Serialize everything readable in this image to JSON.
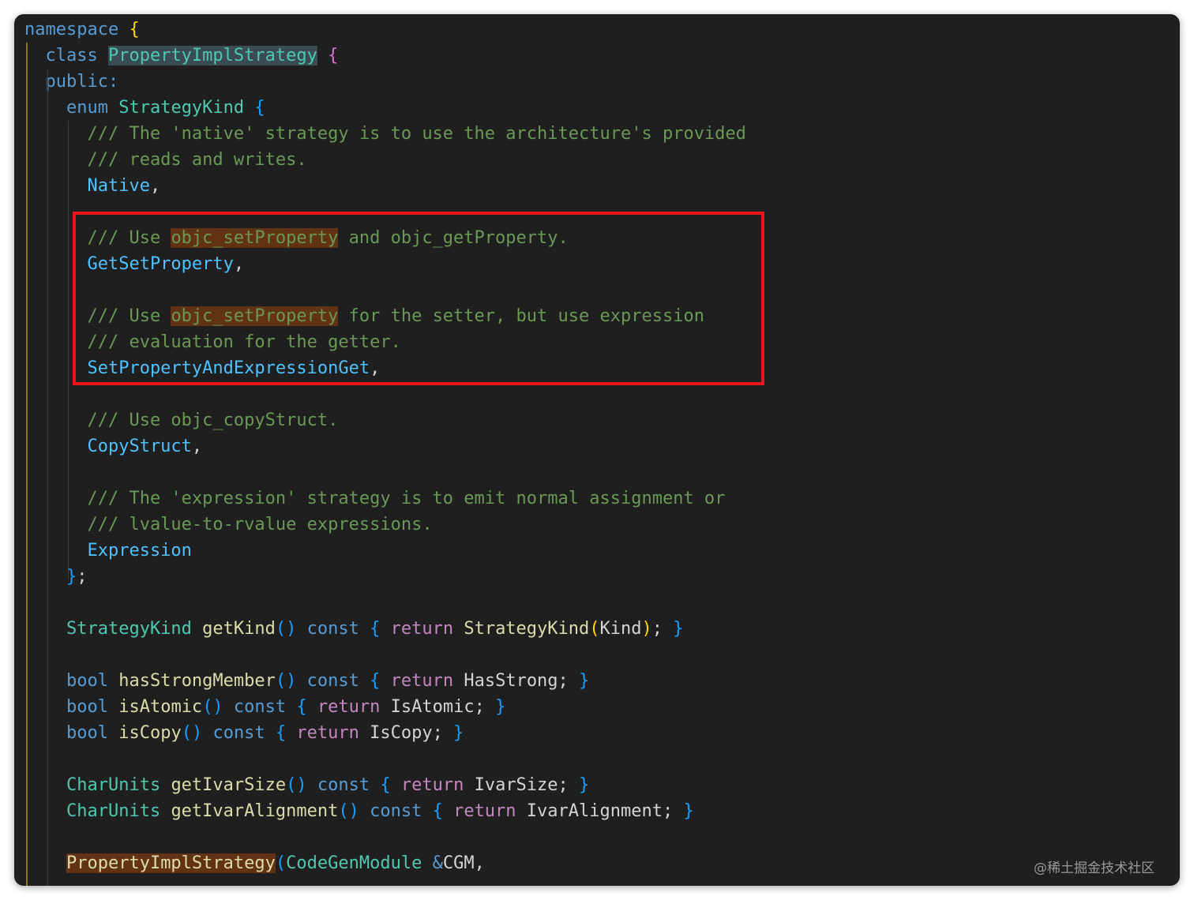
{
  "editor": {
    "lines": [
      {
        "tokens": [
          {
            "t": "namespace",
            "c": "kw"
          },
          {
            "t": " "
          },
          {
            "t": "{",
            "c": "b1"
          }
        ]
      },
      {
        "tokens": [
          {
            "t": "  class ",
            "c": "kw"
          },
          {
            "t": "PropertyImplStrategy",
            "c": "ty hl-class"
          },
          {
            "t": " "
          },
          {
            "t": "{",
            "c": "b2"
          }
        ]
      },
      {
        "tokens": [
          {
            "t": "  public:",
            "c": "kw"
          }
        ]
      },
      {
        "tokens": [
          {
            "t": "    enum ",
            "c": "kw"
          },
          {
            "t": "StrategyKind",
            "c": "ty"
          },
          {
            "t": " "
          },
          {
            "t": "{",
            "c": "b3"
          }
        ]
      },
      {
        "tokens": [
          {
            "t": "      /// The 'native' strategy is to use the architecture's provided",
            "c": "cm"
          }
        ]
      },
      {
        "tokens": [
          {
            "t": "      /// reads and writes.",
            "c": "cm"
          }
        ]
      },
      {
        "tokens": [
          {
            "t": "      Native",
            "c": "en"
          },
          {
            "t": ","
          }
        ]
      },
      {
        "tokens": [
          {
            "t": ""
          }
        ]
      },
      {
        "tokens": [
          {
            "t": "      /// Use ",
            "c": "cm"
          },
          {
            "t": "objc_setProperty",
            "c": "cm hl-word"
          },
          {
            "t": " and objc_getProperty.",
            "c": "cm"
          }
        ]
      },
      {
        "tokens": [
          {
            "t": "      GetSetProperty",
            "c": "en"
          },
          {
            "t": ","
          }
        ]
      },
      {
        "tokens": [
          {
            "t": ""
          }
        ]
      },
      {
        "tokens": [
          {
            "t": "      /// Use ",
            "c": "cm"
          },
          {
            "t": "objc_setProperty",
            "c": "cm hl-word"
          },
          {
            "t": " for the setter, but use expression",
            "c": "cm"
          }
        ]
      },
      {
        "tokens": [
          {
            "t": "      /// evaluation for the getter.",
            "c": "cm"
          }
        ]
      },
      {
        "tokens": [
          {
            "t": "      SetPropertyAndExpressionGet",
            "c": "en"
          },
          {
            "t": ","
          }
        ]
      },
      {
        "tokens": [
          {
            "t": ""
          }
        ]
      },
      {
        "tokens": [
          {
            "t": "      /// Use objc_copyStruct.",
            "c": "cm"
          }
        ]
      },
      {
        "tokens": [
          {
            "t": "      CopyStruct",
            "c": "en"
          },
          {
            "t": ","
          }
        ]
      },
      {
        "tokens": [
          {
            "t": ""
          }
        ]
      },
      {
        "tokens": [
          {
            "t": "      /// The 'expression' strategy is to emit normal assignment or",
            "c": "cm"
          }
        ]
      },
      {
        "tokens": [
          {
            "t": "      /// lvalue-to-rvalue expressions.",
            "c": "cm"
          }
        ]
      },
      {
        "tokens": [
          {
            "t": "      Expression",
            "c": "en"
          }
        ]
      },
      {
        "tokens": [
          {
            "t": "    "
          },
          {
            "t": "}",
            "c": "b3"
          },
          {
            "t": ";"
          }
        ]
      },
      {
        "tokens": [
          {
            "t": ""
          }
        ]
      },
      {
        "tokens": [
          {
            "t": "    StrategyKind",
            "c": "ty"
          },
          {
            "t": " "
          },
          {
            "t": "getKind",
            "c": "fn"
          },
          {
            "t": "()",
            "c": "b3"
          },
          {
            "t": " const ",
            "c": "kw"
          },
          {
            "t": "{",
            "c": "b3"
          },
          {
            "t": " return ",
            "c": "ctl"
          },
          {
            "t": "StrategyKind",
            "c": "fn"
          },
          {
            "t": "(",
            "c": "b1"
          },
          {
            "t": "Kind"
          },
          {
            "t": ")",
            "c": "b1"
          },
          {
            "t": "; "
          },
          {
            "t": "}",
            "c": "b3"
          }
        ]
      },
      {
        "tokens": [
          {
            "t": ""
          }
        ]
      },
      {
        "tokens": [
          {
            "t": "    bool ",
            "c": "kw"
          },
          {
            "t": "hasStrongMember",
            "c": "fn"
          },
          {
            "t": "()",
            "c": "b3"
          },
          {
            "t": " const ",
            "c": "kw"
          },
          {
            "t": "{",
            "c": "b3"
          },
          {
            "t": " return ",
            "c": "ctl"
          },
          {
            "t": "HasStrong; "
          },
          {
            "t": "}",
            "c": "b3"
          }
        ]
      },
      {
        "tokens": [
          {
            "t": "    bool ",
            "c": "kw"
          },
          {
            "t": "isAtomic",
            "c": "fn"
          },
          {
            "t": "()",
            "c": "b3"
          },
          {
            "t": " const ",
            "c": "kw"
          },
          {
            "t": "{",
            "c": "b3"
          },
          {
            "t": " return ",
            "c": "ctl"
          },
          {
            "t": "IsAtomic; "
          },
          {
            "t": "}",
            "c": "b3"
          }
        ]
      },
      {
        "tokens": [
          {
            "t": "    bool ",
            "c": "kw"
          },
          {
            "t": "isCopy",
            "c": "fn"
          },
          {
            "t": "()",
            "c": "b3"
          },
          {
            "t": " const ",
            "c": "kw"
          },
          {
            "t": "{",
            "c": "b3"
          },
          {
            "t": " return ",
            "c": "ctl"
          },
          {
            "t": "IsCopy; "
          },
          {
            "t": "}",
            "c": "b3"
          }
        ]
      },
      {
        "tokens": [
          {
            "t": ""
          }
        ]
      },
      {
        "tokens": [
          {
            "t": "    CharUnits",
            "c": "ty"
          },
          {
            "t": " "
          },
          {
            "t": "getIvarSize",
            "c": "fn"
          },
          {
            "t": "()",
            "c": "b3"
          },
          {
            "t": " const ",
            "c": "kw"
          },
          {
            "t": "{",
            "c": "b3"
          },
          {
            "t": " return ",
            "c": "ctl"
          },
          {
            "t": "IvarSize; "
          },
          {
            "t": "}",
            "c": "b3"
          }
        ]
      },
      {
        "tokens": [
          {
            "t": "    CharUnits",
            "c": "ty"
          },
          {
            "t": " "
          },
          {
            "t": "getIvarAlignment",
            "c": "fn"
          },
          {
            "t": "()",
            "c": "b3"
          },
          {
            "t": " const ",
            "c": "kw"
          },
          {
            "t": "{",
            "c": "b3"
          },
          {
            "t": " return ",
            "c": "ctl"
          },
          {
            "t": "IvarAlignment; "
          },
          {
            "t": "}",
            "c": "b3"
          }
        ]
      },
      {
        "tokens": [
          {
            "t": ""
          }
        ]
      },
      {
        "tokens": [
          {
            "t": "    "
          },
          {
            "t": "PropertyImplStrategy",
            "c": "fn hl-word"
          },
          {
            "t": "(",
            "c": "b3"
          },
          {
            "t": "CodeGenModule",
            "c": "ty"
          },
          {
            "t": " "
          },
          {
            "t": "&",
            "c": "kw"
          },
          {
            "t": "CGM,"
          }
        ]
      }
    ]
  },
  "watermark": "@稀土掘金技术社区"
}
